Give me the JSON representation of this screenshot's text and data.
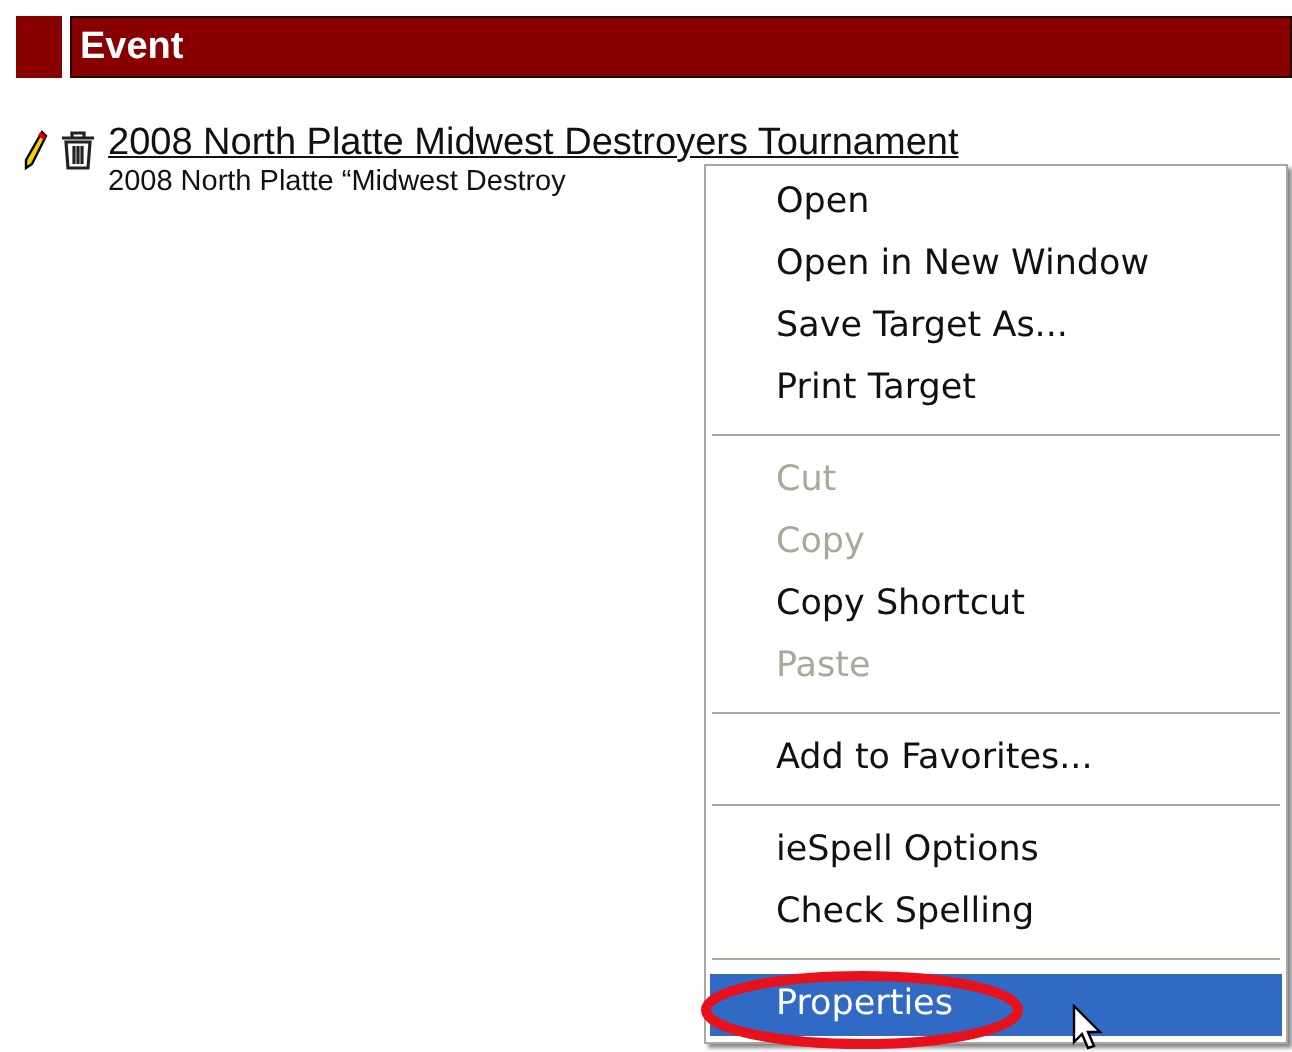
{
  "header": {
    "title": "Event"
  },
  "event": {
    "title": "2008 North Platte Midwest Destroyers Tournament",
    "description": "2008 North Platte “Midwest Destroy"
  },
  "context_menu": {
    "items": [
      {
        "kind": "item",
        "label": "Open",
        "disabled": false,
        "selected": false
      },
      {
        "kind": "item",
        "label": "Open in New Window",
        "disabled": false,
        "selected": false
      },
      {
        "kind": "item",
        "label": "Save Target As...",
        "disabled": false,
        "selected": false
      },
      {
        "kind": "item",
        "label": "Print Target",
        "disabled": false,
        "selected": false
      },
      {
        "kind": "separator"
      },
      {
        "kind": "item",
        "label": "Cut",
        "disabled": true,
        "selected": false
      },
      {
        "kind": "item",
        "label": "Copy",
        "disabled": true,
        "selected": false
      },
      {
        "kind": "item",
        "label": "Copy Shortcut",
        "disabled": false,
        "selected": false
      },
      {
        "kind": "item",
        "label": "Paste",
        "disabled": true,
        "selected": false
      },
      {
        "kind": "separator"
      },
      {
        "kind": "item",
        "label": "Add to Favorites...",
        "disabled": false,
        "selected": false
      },
      {
        "kind": "separator"
      },
      {
        "kind": "item",
        "label": "ieSpell Options",
        "disabled": false,
        "selected": false
      },
      {
        "kind": "item",
        "label": "Check Spelling",
        "disabled": false,
        "selected": false
      },
      {
        "kind": "separator"
      },
      {
        "kind": "item",
        "label": "Properties",
        "disabled": false,
        "selected": true
      }
    ]
  }
}
